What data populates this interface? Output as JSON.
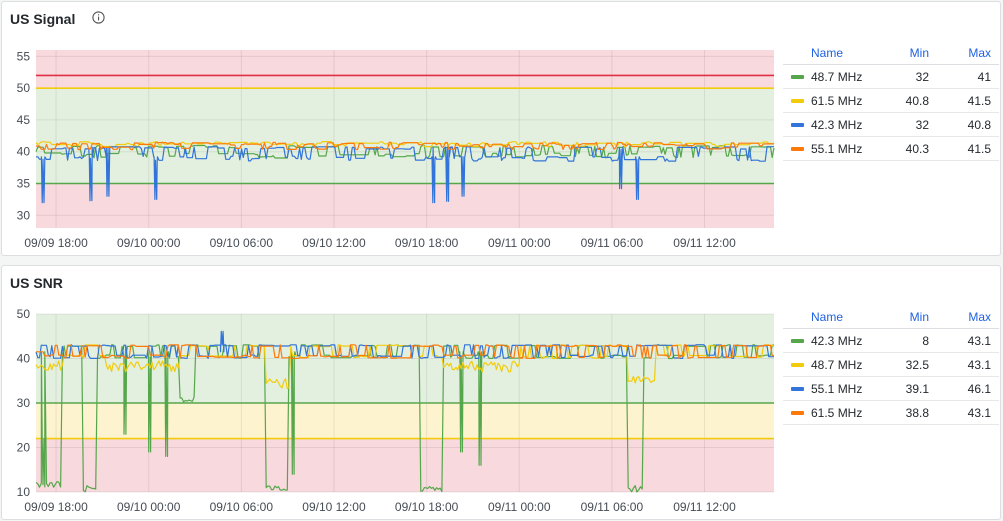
{
  "panels": [
    {
      "title": "US Signal",
      "info_icon": "info-circle-icon",
      "legend": {
        "headers": {
          "name": "Name",
          "min": "Min",
          "max": "Max"
        },
        "rows": [
          {
            "name": "48.7 MHz",
            "min": "32",
            "max": "41",
            "color": "#56a64b"
          },
          {
            "name": "61.5 MHz",
            "min": "40.8",
            "max": "41.5",
            "color": "#f2cc0c"
          },
          {
            "name": "42.3 MHz",
            "min": "32",
            "max": "40.8",
            "color": "#3274d9"
          },
          {
            "name": "55.1 MHz",
            "min": "40.3",
            "max": "41.5",
            "color": "#ff780a"
          }
        ]
      }
    },
    {
      "title": "US SNR",
      "legend": {
        "headers": {
          "name": "Name",
          "min": "Min",
          "max": "Max"
        },
        "rows": [
          {
            "name": "42.3 MHz",
            "min": "8",
            "max": "43.1",
            "color": "#56a64b"
          },
          {
            "name": "48.7 MHz",
            "min": "32.5",
            "max": "43.1",
            "color": "#f2cc0c"
          },
          {
            "name": "55.1 MHz",
            "min": "39.1",
            "max": "46.1",
            "color": "#3274d9"
          },
          {
            "name": "61.5 MHz",
            "min": "38.8",
            "max": "43.1",
            "color": "#ff780a"
          }
        ]
      }
    }
  ],
  "chart_data": [
    {
      "type": "line",
      "title": "US Signal",
      "ylim": [
        28,
        56
      ],
      "y_ticks": [
        "30",
        "35",
        "40",
        "45",
        "50",
        "55"
      ],
      "x_ticks": [
        "09/09 18:00",
        "09/10 00:00",
        "09/10 06:00",
        "09/10 12:00",
        "09/10 18:00",
        "09/11 00:00",
        "09/11 06:00",
        "09/11 12:00"
      ],
      "x_range_hours": [
        -1.3,
        46.5
      ],
      "x_unit": "hours since 09/09 18:00",
      "grid": true,
      "legend_position": "right",
      "bands": [
        {
          "from": 28,
          "to": 35,
          "color": "#f8d9dd"
        },
        {
          "from": 35,
          "to": 50,
          "color": "#e3f0df"
        },
        {
          "from": 50,
          "to": 56,
          "color": "#f8d9dd"
        }
      ],
      "thresholds": [
        {
          "value": 35,
          "color": "#56a64b"
        },
        {
          "value": 50,
          "color": "#f2cc0c"
        },
        {
          "value": 52,
          "color": "#e02f44"
        }
      ],
      "series": [
        {
          "name": "48.7 MHz",
          "color": "#56a64b",
          "base": 40,
          "low": 39,
          "high": 41,
          "dips": []
        },
        {
          "name": "61.5 MHz",
          "color": "#f2cc0c",
          "base": 41,
          "low": 40.8,
          "high": 41.5,
          "dips": []
        },
        {
          "name": "42.3 MHz",
          "color": "#3274d9",
          "base": 39.2,
          "low": 38.5,
          "high": 40.8,
          "dips": [
            [
              -0.9,
              32
            ],
            [
              2.2,
              32.3
            ],
            [
              3.3,
              33
            ],
            [
              6.4,
              32.5
            ],
            [
              24.4,
              32
            ],
            [
              25.3,
              32.2
            ],
            [
              26.3,
              33
            ],
            [
              36.5,
              34.2
            ],
            [
              37.6,
              32.5
            ]
          ]
        },
        {
          "name": "55.1 MHz",
          "color": "#ff780a",
          "base": 40.9,
          "low": 40.3,
          "high": 41.5,
          "dips": []
        }
      ]
    },
    {
      "type": "line",
      "title": "US SNR",
      "ylim": [
        10,
        50
      ],
      "y_ticks": [
        "10",
        "20",
        "30",
        "40",
        "50"
      ],
      "x_ticks": [
        "09/09 18:00",
        "09/10 00:00",
        "09/10 06:00",
        "09/10 12:00",
        "09/10 18:00",
        "09/11 00:00",
        "09/11 06:00",
        "09/11 12:00"
      ],
      "x_range_hours": [
        -1.3,
        46.5
      ],
      "x_unit": "hours since 09/09 18:00",
      "grid": true,
      "legend_position": "right",
      "bands": [
        {
          "from": 10,
          "to": 22,
          "color": "#f8d9dd"
        },
        {
          "from": 22,
          "to": 30,
          "color": "#fdf4cf"
        },
        {
          "from": 30,
          "to": 50,
          "color": "#e3f0df"
        }
      ],
      "thresholds": [
        {
          "value": 22,
          "color": "#f2cc0c"
        },
        {
          "value": 30,
          "color": "#56a64b"
        }
      ],
      "series": [
        {
          "name": "42.3 MHz",
          "color": "#56a64b",
          "base": 41.5,
          "low": 40,
          "high": 43.1,
          "drops": [
            [
              -1.3,
              0.3,
              11
            ],
            [
              1.7,
              2.6,
              10
            ],
            [
              8.0,
              9.0,
              30
            ],
            [
              13.6,
              15.0,
              10
            ],
            [
              23.6,
              25.0,
              10
            ],
            [
              37.0,
              38.0,
              10
            ]
          ],
          "spikes": [
            [
              -0.9,
              22
            ],
            [
              4.4,
              23
            ],
            [
              6.0,
              19
            ],
            [
              7.1,
              18
            ],
            [
              15.3,
              14
            ],
            [
              26.2,
              19
            ],
            [
              27.4,
              16
            ]
          ]
        },
        {
          "name": "48.7 MHz",
          "color": "#f2cc0c",
          "base": 41.5,
          "low": 32.5,
          "high": 43.1,
          "low_periods": [
            [
              -1.3,
              0.5,
              37
            ],
            [
              3.2,
              8.0,
              37
            ],
            [
              13.6,
              15.2,
              33
            ],
            [
              25.0,
              30.0,
              37
            ],
            [
              37.0,
              38.8,
              34
            ]
          ]
        },
        {
          "name": "55.1 MHz",
          "color": "#3274d9",
          "base": 41.5,
          "low": 39.1,
          "high": 46.1,
          "spikes": [
            [
              10.7,
              46.1
            ]
          ]
        },
        {
          "name": "61.5 MHz",
          "color": "#ff780a",
          "base": 41.5,
          "low": 38.8,
          "high": 43.1
        }
      ]
    }
  ]
}
